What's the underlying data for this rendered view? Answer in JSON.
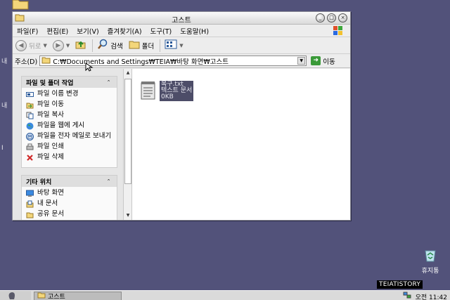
{
  "desktop": {
    "edge_labels": [
      "내",
      "내",
      "I"
    ],
    "recycle_label": "휴지통"
  },
  "window": {
    "title": "고스트",
    "buttons": [
      "_",
      "□",
      "×"
    ]
  },
  "menubar": {
    "items": [
      "파일(F)",
      "편집(E)",
      "보기(V)",
      "즐겨찾기(A)",
      "도구(T)",
      "도움말(H)"
    ]
  },
  "toolbar": {
    "back_label": "뒤로",
    "search_label": "검색",
    "folders_label": "폴더"
  },
  "address": {
    "label": "주소(D)",
    "value": "C:₩Documents and Settings₩TEIA₩바탕 화면₩고스트",
    "go_label": "이동"
  },
  "task_pane": {
    "file_tasks_title": "파일 및 폴더 작업",
    "file_tasks": [
      "파일 이름 변경",
      "파일 이동",
      "파일 복사",
      "파일을 웹에 게시",
      "파일을 전자 메일로 보내기",
      "파일 인쇄",
      "파일 삭제"
    ],
    "other_places_title": "기타 위치",
    "other_places": [
      "바탕 화면",
      "내 문서",
      "공유 문서"
    ]
  },
  "file": {
    "name": "복구.txt",
    "type": "텍스트 문서",
    "size": "0KB"
  },
  "taskbar": {
    "task_label": "고스트",
    "clock": "오전 11:42"
  },
  "watermark": "TEIATISTORY"
}
